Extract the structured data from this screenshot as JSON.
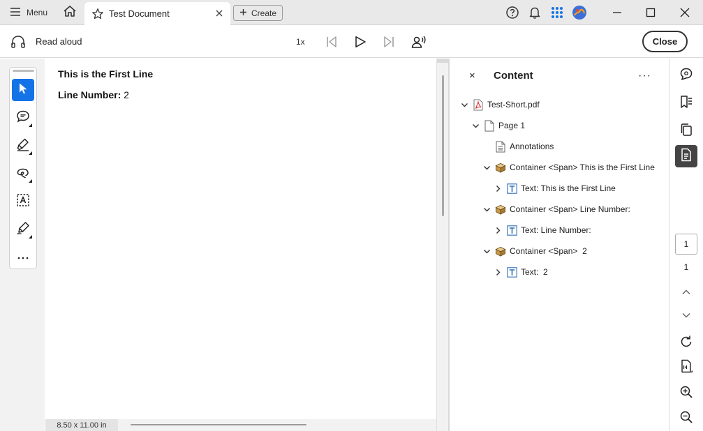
{
  "titlebar": {
    "menu_label": "Menu",
    "tab_title": "Test Document",
    "create_label": "Create"
  },
  "readaloud": {
    "label": "Read aloud",
    "speed": "1x",
    "close_label": "Close"
  },
  "document": {
    "line1": "This is the First Line",
    "line2_label": "Line Number:",
    "line2_value": "2",
    "page_size": "8.50 x 11.00 in"
  },
  "content_panel": {
    "title": "Content",
    "close_glyph": "×",
    "more_glyph": "···",
    "tree": [
      {
        "label": "Test-Short.pdf",
        "icon": "pdf-icon",
        "chevron": "down"
      },
      {
        "label": "Page 1",
        "icon": "page-icon",
        "chevron": "down"
      },
      {
        "label": "Annotations",
        "icon": "page-icon",
        "chevron": "none"
      },
      {
        "label": "Container <Span> This is the First Line",
        "icon": "container-icon",
        "chevron": "down"
      },
      {
        "label": "Text: This is the First Line",
        "icon": "text-icon",
        "chevron": "right"
      },
      {
        "label": "Container <Span> Line Number:",
        "icon": "container-icon",
        "chevron": "down"
      },
      {
        "label": "Text: Line Number:",
        "icon": "text-icon",
        "chevron": "right"
      },
      {
        "label": "Container <Span>  2",
        "icon": "container-icon",
        "chevron": "down"
      },
      {
        "label": "Text:  2",
        "icon": "text-icon",
        "chevron": "right"
      }
    ]
  },
  "rightrail": {
    "page_input": "1",
    "page_count": "1"
  },
  "colors": {
    "accent": "#1473e6",
    "titlebar_bg": "#e9e9e9",
    "active_rail": "#444444"
  }
}
